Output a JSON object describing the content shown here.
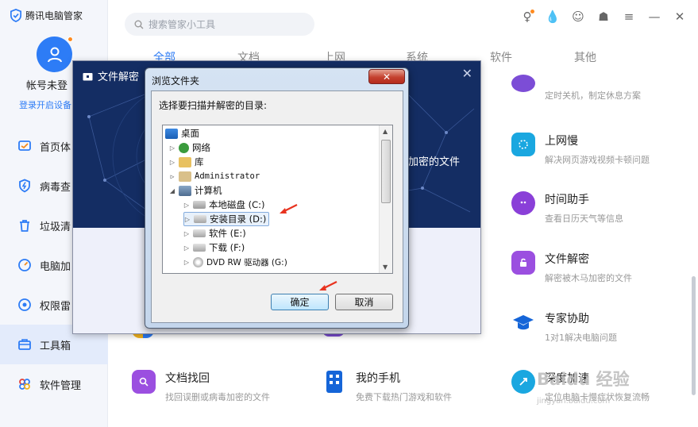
{
  "app": {
    "brand": "腾讯电脑管家",
    "account_name": "帐号未登",
    "login_link": "登录开启设备"
  },
  "sidebar": {
    "items": [
      {
        "label": "首页体",
        "icon": "home-check-icon",
        "color": "#2d7cf6"
      },
      {
        "label": "病毒查",
        "icon": "virus-shield-icon",
        "color": "#2d7cf6"
      },
      {
        "label": "垃圾清",
        "icon": "trash-icon",
        "color": "#2d7cf6"
      },
      {
        "label": "电脑加",
        "icon": "rocket-icon",
        "color": "#2d7cf6"
      },
      {
        "label": "权限雷",
        "icon": "radar-icon",
        "color": "#2d7cf6"
      },
      {
        "label": "工具箱",
        "icon": "toolbox-icon",
        "color": "#2d7cf6",
        "active": true
      },
      {
        "label": "软件管理",
        "icon": "apps-icon",
        "color": "#e0403a"
      }
    ]
  },
  "search": {
    "placeholder": "搜索管家小工具"
  },
  "tabs": [
    "全部",
    "文档",
    "上网",
    "系统",
    "软件",
    "其他"
  ],
  "tools": {
    "shutdown": {
      "desc": "定时关机，制定休息方案"
    },
    "net_slow": {
      "name": "上网慢",
      "desc": "解决网页游戏视频卡顿问题"
    },
    "time_helper": {
      "name": "时间助手",
      "desc": "查看日历天气等信息"
    },
    "file_decrypt": {
      "name": "文件解密",
      "desc": "解密被木马加密的文件"
    },
    "expert_help": {
      "name": "专家协助",
      "desc": "1对1解决电脑问题"
    },
    "doc_recover": {
      "name": "文档找回",
      "desc": "找回误删或病毒加密的文件"
    },
    "my_phone": {
      "name": "我的手机",
      "desc": "免费下载热门游戏和软件"
    },
    "deep_speed": {
      "name": "深度加速",
      "desc": "定位电脑卡慢症状恢复流畅"
    }
  },
  "decrypt_dialog": {
    "title": "文件解密",
    "banner_text": "加密的文件"
  },
  "browse_dialog": {
    "title": "浏览文件夹",
    "prompt": "选择要扫描并解密的目录:",
    "tree": {
      "desktop": "桌面",
      "network": "网络",
      "library": "库",
      "admin": "Administrator",
      "computer": "计算机",
      "disk_c": "本地磁盘 (C:)",
      "disk_d": "安装目录 (D:)",
      "disk_e": "软件 (E:)",
      "disk_f": "下载 (F:)",
      "disk_g": "DVD RW 驱动器 (G:)"
    },
    "ok_label": "确定",
    "cancel_label": "取消"
  },
  "watermark": {
    "text": "Baidu 经验",
    "sub": "jingyan.baidu.com"
  },
  "colors": {
    "accent": "#2d7cf6",
    "dialog_bg": "#142d63",
    "arrow": "#e8331f"
  }
}
